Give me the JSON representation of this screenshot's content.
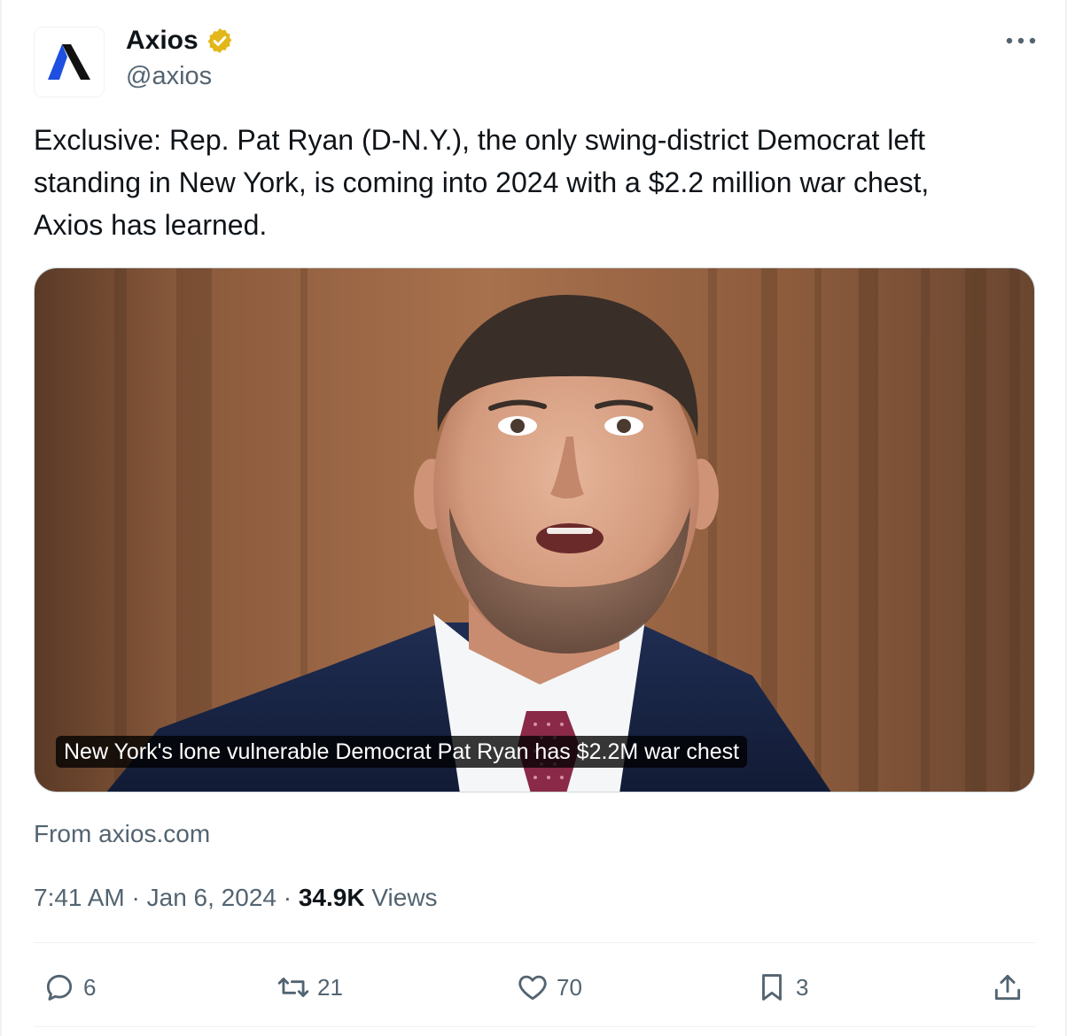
{
  "account": {
    "name": "Axios",
    "handle": "@axios",
    "avatar_icon": "axios-logo",
    "verified_icon": "verified-gold-badge-icon"
  },
  "tweet": {
    "text": "Exclusive: Rep. Pat Ryan (D-N.Y.), the only swing-district Democrat left\nstanding in New York, is coming into 2024 with a $2.2 million war chest,\nAxios has learned.",
    "media_caption": "New York's lone vulnerable Democrat Pat Ryan has $2.2M war chest",
    "source": "From axios.com",
    "time": "7:41 AM",
    "separator": "·",
    "date": "Jan 6, 2024",
    "views_count": "34.9K",
    "views_label": "Views"
  },
  "actions": {
    "replies": "6",
    "reposts": "21",
    "likes": "70",
    "bookmarks": "3",
    "icons": [
      "reply-icon",
      "repost-icon",
      "like-icon",
      "bookmark-icon",
      "share-icon"
    ]
  },
  "colors": {
    "text_primary": "#0f1419",
    "text_secondary": "#536471",
    "axios_blue": "#1d4fe0",
    "verified_gold": "#e2b719",
    "divider": "#eff3f4"
  }
}
